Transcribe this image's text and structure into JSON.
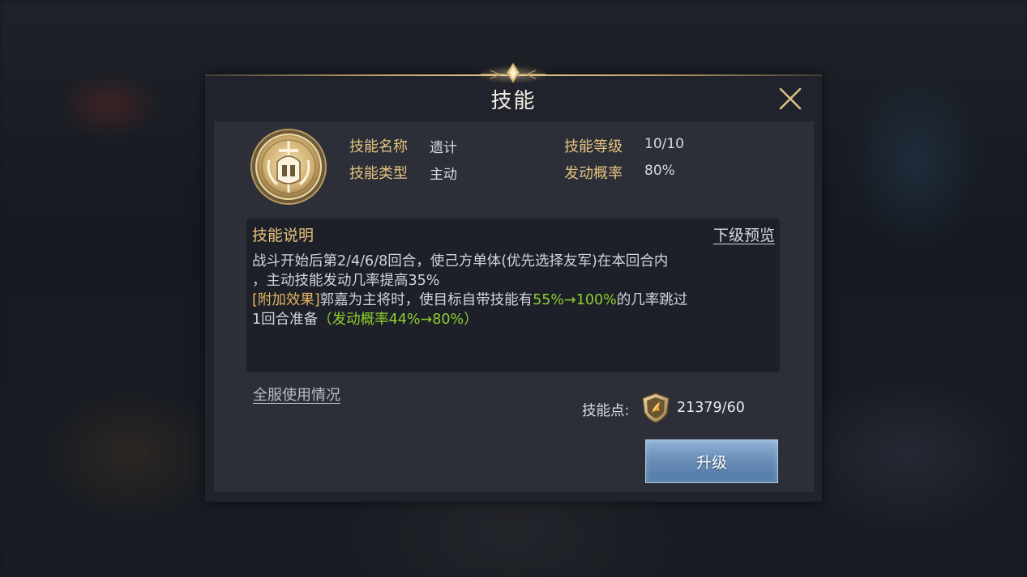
{
  "dialog": {
    "title": "技能",
    "close_icon": "close-icon"
  },
  "skill": {
    "icon": "helmet-sword-emblem-icon",
    "name_label": "技能名称",
    "name_value": "遗计",
    "type_label": "技能类型",
    "type_value": "主动",
    "level_label": "技能等级",
    "level_value": "10/10",
    "rate_label": "发动概率",
    "rate_value": "80%"
  },
  "description": {
    "title": "技能说明",
    "next_preview": "下级预览",
    "line1": "战斗开始后第2/4/6/8回合，使己方单体(优先选择友军)在本回合内",
    "line2": "，主动技能发动几率提高35%",
    "bonus_tag": "[附加效果]",
    "bonus_text1": "郭嘉为主将时，使目标自带技能有",
    "bonus_chance": "55%→100%",
    "bonus_text2": "的几率跳过",
    "bonus_text3": "1回合准备",
    "bonus_rate": "（发动概率44%→80%）"
  },
  "footer": {
    "server_usage": "全服使用情况",
    "points_label": "技能点:",
    "points_icon": "skill-point-shield-icon",
    "points_value": "21379/60",
    "upgrade_button": "升级"
  },
  "colors": {
    "gold_label": "#e4c27f",
    "highlight_green": "#8fcf2f",
    "bonus_tag": "#e6b560",
    "button_blue": "#6a8fb8"
  }
}
